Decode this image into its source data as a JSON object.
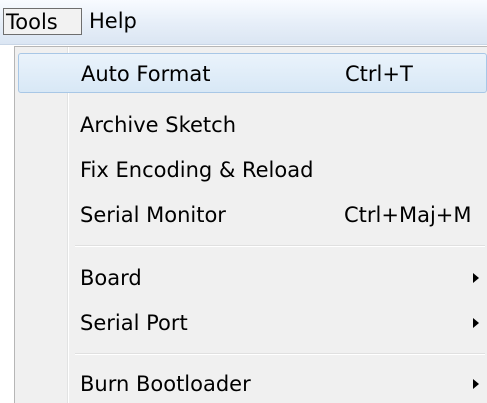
{
  "menubar": {
    "tools_label": "Tools",
    "help_label": "Help"
  },
  "tools_menu": {
    "items": [
      {
        "label": "Auto Format",
        "shortcut": "Ctrl+T",
        "hovered": true
      },
      {
        "label": "Archive Sketch",
        "shortcut": ""
      },
      {
        "label": "Fix Encoding & Reload",
        "shortcut": ""
      },
      {
        "label": "Serial Monitor",
        "shortcut": "Ctrl+Maj+M"
      },
      {
        "label": "Board",
        "submenu": true
      },
      {
        "label": "Serial Port",
        "submenu": true
      },
      {
        "label": "Burn Bootloader",
        "submenu": true
      }
    ]
  },
  "icons": {
    "submenu_arrow": "chevron-right-icon"
  },
  "colors": {
    "hover_fill": "#d8e8f6",
    "hover_border": "#a8c7e6",
    "menu_background": "#f0f0f0"
  }
}
